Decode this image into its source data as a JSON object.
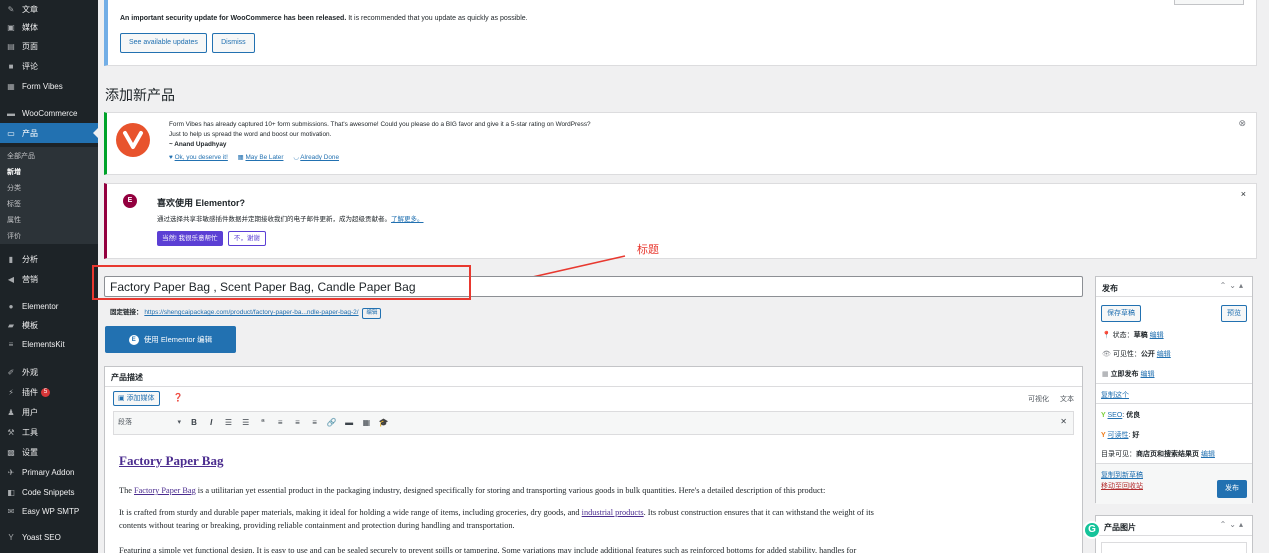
{
  "sidebar": {
    "items": [
      {
        "label": "文章",
        "icon": "pin-icon"
      },
      {
        "label": "媒体",
        "icon": "media-icon"
      },
      {
        "label": "页面",
        "icon": "page-icon"
      },
      {
        "label": "评论",
        "icon": "comment-icon"
      },
      {
        "label": "Form Vibes",
        "icon": "form-icon"
      },
      {
        "label": "WooCommerce",
        "icon": "woocommerce-icon"
      },
      {
        "label": "产品",
        "icon": "archive-icon"
      },
      {
        "label": "分析",
        "icon": "chart-icon"
      },
      {
        "label": "营销",
        "icon": "megaphone-icon"
      },
      {
        "label": "Elementor",
        "icon": "elementor-icon"
      },
      {
        "label": "模板",
        "icon": "folder-icon"
      },
      {
        "label": "ElementsKit",
        "icon": "elementskit-icon"
      },
      {
        "label": "外观",
        "icon": "brush-icon"
      },
      {
        "label": "插件",
        "icon": "plugin-icon",
        "badge": "5"
      },
      {
        "label": "用户",
        "icon": "user-icon"
      },
      {
        "label": "工具",
        "icon": "wrench-icon"
      },
      {
        "label": "设置",
        "icon": "settings-icon"
      },
      {
        "label": "Primary Addon",
        "icon": "addon-icon"
      },
      {
        "label": "Code Snippets",
        "icon": "code-icon"
      },
      {
        "label": "Easy WP SMTP",
        "icon": "mail-icon"
      },
      {
        "label": "Yoast SEO",
        "icon": "yoast-icon"
      }
    ],
    "submenu": [
      "全部产品",
      "新增",
      "分类",
      "标签",
      "属性",
      "评价"
    ]
  },
  "update_notice": {
    "message_bold": "An important security update for WooCommerce has been released.",
    "message_rest": " It is recommended that you update as quickly as possible.",
    "see_updates": "See available updates",
    "dismiss": "Dismiss"
  },
  "page_title": "添加新产品",
  "formvibes_notice": {
    "line1": "Form Vibes has already captured 10+ form submissions. That's awesome! Could you please do a BIG favor and give it a 5-star rating on WordPress?",
    "line2": "Just to help us spread the word and boost our motivation.",
    "author": "~ Anand Upadhyay",
    "link1": "Ok, you deserve it!",
    "link2": "May Be Later",
    "link3": "Already Done"
  },
  "elementor_notice": {
    "title": "喜欢使用 Elementor?",
    "text": "通过选择共享非敏感插件数据并定期接收我们的电子邮件更新，成为超级贡献者。",
    "learn_more": "了解更多。",
    "yes_btn": "当然! 我很乐意帮忙",
    "no_btn": "不，谢谢"
  },
  "annotation": {
    "label": "标题",
    "color": "#e8382f"
  },
  "post_title": "Factory Paper Bag , Scent Paper Bag, Candle Paper Bag",
  "permalink": {
    "label": "固定链接：",
    "url": "https://shengcaipackage.com/product/factory-paper-ba...ndle-paper-bag-2/",
    "edit": "编辑"
  },
  "elementor_edit_button": "使用 Elementor 编辑",
  "description": {
    "box_title": "产品描述",
    "add_media": "添加媒体",
    "tab_visual": "可视化",
    "tab_text": "文本",
    "format_select": "段落",
    "heading": "Factory Paper Bag",
    "p1_before": "The ",
    "p1_link": "Factory Paper Bag",
    "p1_after": " is a utilitarian yet essential product in the packaging industry, designed specifically for storing and transporting various goods in bulk quantities. Here's a detailed description of this product:",
    "p2_before": "It is crafted from sturdy and durable paper materials, making it ideal for holding a wide range of items, including groceries, dry goods, and ",
    "p2_link": "industrial products",
    "p2_after": ". Its robust construction ensures that it can withstand the weight of its",
    "p2_line2": "contents without tearing or breaking, providing reliable containment and protection during handling and transportation.",
    "p3": "Featuring a simple yet functional design. It is easy to use and can be sealed securely to prevent spills or tampering. Some variations may include additional features such as reinforced bottoms for added stability, handles for"
  },
  "publish": {
    "title": "发布",
    "save_draft": "保存草稿",
    "preview": "预览",
    "status_label": "状态：",
    "status_value": "草稿",
    "visibility_label": "可见性：",
    "visibility_value": "公开",
    "publish_time": "立即发布",
    "edit": "编辑",
    "copy": "复制这个",
    "seo_label": "SEO",
    "seo_value": "优良",
    "readability_label": "可读性",
    "readability_value": "好",
    "catalog_label": "目录可见：",
    "catalog_value": "商店页和搜索结果页",
    "copy_draft": "复制到新草稿",
    "trash": "移动至回收站",
    "publish_btn": "发布"
  },
  "product_image": {
    "title": "产品图片"
  }
}
